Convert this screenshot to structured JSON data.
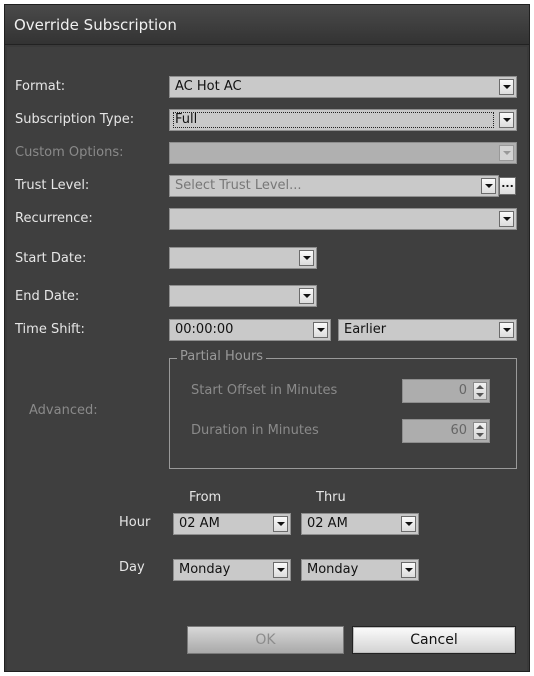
{
  "dialog": {
    "title": "Override Subscription"
  },
  "fields": {
    "format": {
      "label": "Format:",
      "value": "AC Hot AC"
    },
    "subscription_type": {
      "label": "Subscription Type:",
      "value": "Full"
    },
    "custom_options": {
      "label": "Custom Options:",
      "value": ""
    },
    "trust_level": {
      "label": "Trust Level:",
      "placeholder": "Select Trust Level...",
      "browse_label": "..."
    },
    "recurrence": {
      "label": "Recurrence:",
      "value": ""
    },
    "start_date": {
      "label": "Start Date:",
      "value": ""
    },
    "end_date": {
      "label": "End Date:",
      "value": ""
    },
    "time_shift": {
      "label": "Time Shift:",
      "time": "00:00:00",
      "direction": "Earlier"
    }
  },
  "advanced": {
    "label": "Advanced:",
    "group_title": "Partial Hours",
    "start_offset": {
      "label": "Start Offset in Minutes",
      "value": "0"
    },
    "duration": {
      "label": "Duration in Minutes",
      "value": "60"
    }
  },
  "schedule": {
    "from_label": "From",
    "thru_label": "Thru",
    "hour": {
      "label": "Hour",
      "from": "02 AM",
      "thru": "02 AM"
    },
    "day": {
      "label": "Day",
      "from": "Monday",
      "thru": "Monday"
    }
  },
  "buttons": {
    "ok": "OK",
    "cancel": "Cancel"
  },
  "colors": {
    "background": "#3f3f3f",
    "field": "#c9c9c9",
    "label": "#e6e6e6",
    "disabled": "#8a8a8a"
  }
}
